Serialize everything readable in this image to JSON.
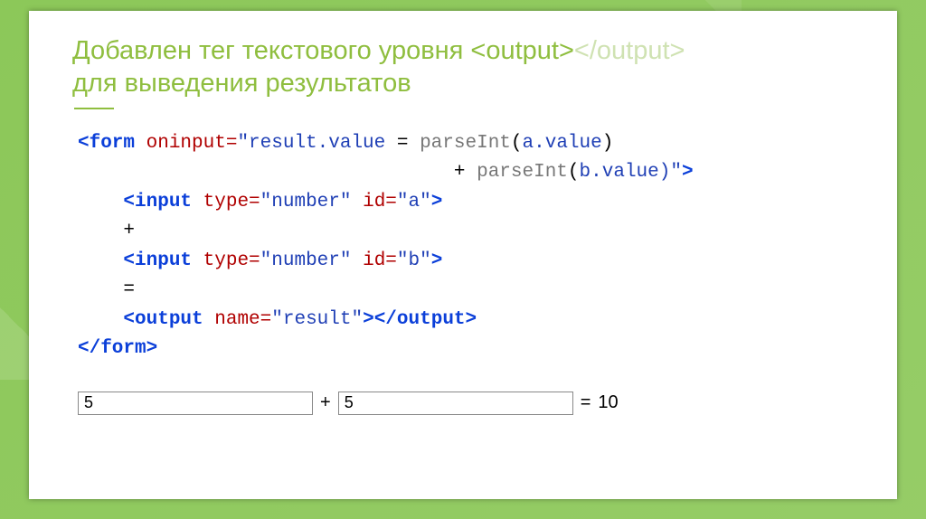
{
  "title": {
    "line1_prefix": "Добавлен тег текстового уровня ",
    "tag_open": "<output>",
    "tag_close": "</output>",
    "line2": "для выведения результатов"
  },
  "code": {
    "line1": {
      "tag_open": "<form",
      "attr": " oninput=",
      "val_open": "\"result.value",
      "punct_eq": " = ",
      "call1": "parseInt",
      "p_open1": "(",
      "arg_a": "a.value",
      "p_close1": ")"
    },
    "line2": {
      "indent": "                                 ",
      "plus": "+ ",
      "call2": "parseInt",
      "p_open2": "(",
      "arg_b": "b.value",
      "p_close2": ")\"",
      "tag_close": ">"
    },
    "line3": {
      "indent": "    ",
      "tag_open": "<input",
      "attr1": " type=",
      "val1": "\"number\"",
      "attr2": " id=",
      "val2": "\"a\"",
      "tag_close": ">"
    },
    "line4": {
      "indent": "    ",
      "text": "+"
    },
    "line5": {
      "indent": "    ",
      "tag_open": "<input",
      "attr1": " type=",
      "val1": "\"number\"",
      "attr2": " id=",
      "val2": "\"b\"",
      "tag_close": ">"
    },
    "line6": {
      "indent": "    ",
      "text": "="
    },
    "line7": {
      "indent": "    ",
      "tag_open": "<output",
      "attr": " name=",
      "val": "\"result\"",
      "tag_mid": ">",
      "tag_end": "</output>"
    },
    "line8": {
      "tag": "</form>"
    }
  },
  "result": {
    "a": "5",
    "plus": "+",
    "b": "5",
    "equals": "=",
    "out": "10"
  }
}
